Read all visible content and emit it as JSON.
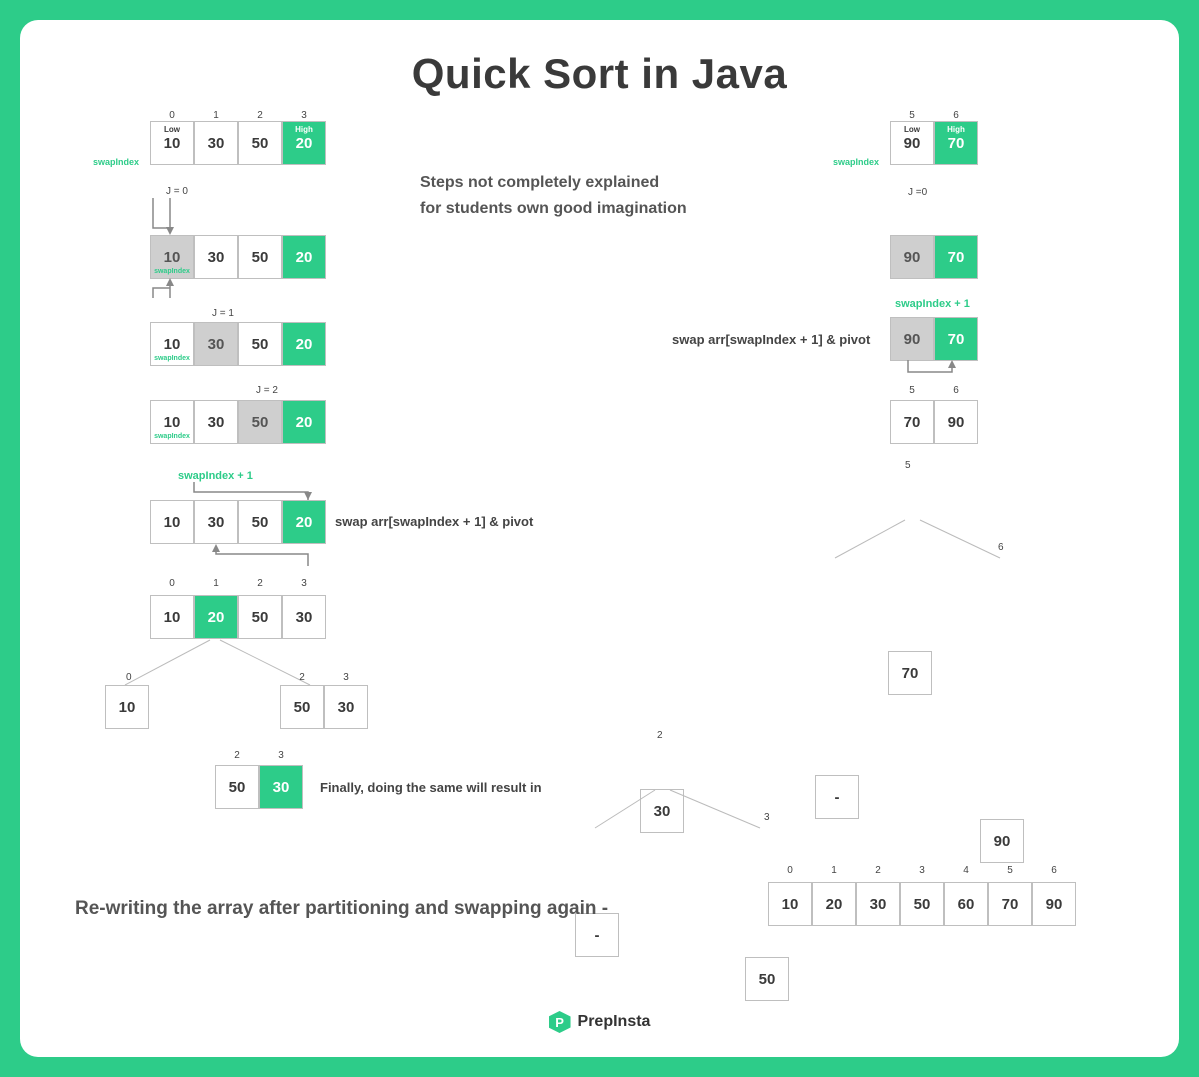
{
  "title": "Quick Sort in Java",
  "subtitle_line1": "Steps not completely explained",
  "subtitle_line2": "for students own good imagination",
  "labels": {
    "swapIndex": "swapIndex",
    "swapIndexPlus1": "swapIndex + 1",
    "low": "Low",
    "high": "High",
    "j0": "J = 0",
    "j1": "J = 1",
    "j2": "J = 2",
    "j0b": "J =0",
    "swapNote": "swap arr[swapIndex + 1] & pivot",
    "finallyNote": "Finally, doing the same will result in",
    "rewrite": "Re-writing the array after partitioning and swapping again -",
    "brand": "PrepInsta",
    "dash": "-"
  },
  "left": {
    "indices": [
      "0",
      "1",
      "2",
      "3"
    ],
    "row1": [
      "10",
      "30",
      "50",
      "20"
    ],
    "row2": [
      "10",
      "30",
      "50",
      "20"
    ],
    "row3": [
      "10",
      "30",
      "50",
      "20"
    ],
    "row4": [
      "10",
      "30",
      "50",
      "20"
    ],
    "row5": [
      "10",
      "30",
      "50",
      "20"
    ],
    "row6": [
      "10",
      "20",
      "50",
      "30"
    ],
    "leaf10": "10",
    "leaf5030": [
      "50",
      "30"
    ],
    "final5030": [
      "50",
      "30"
    ]
  },
  "right": {
    "indices": [
      "5",
      "6"
    ],
    "row1": [
      "90",
      "70"
    ],
    "row2": [
      "90",
      "70"
    ],
    "row3": [
      "90",
      "70"
    ],
    "row4": [
      "70",
      "90"
    ],
    "node70": "70",
    "leafDash": "-",
    "leaf90": "90"
  },
  "tree30": {
    "root": "30",
    "left": "-",
    "right": "50"
  },
  "final": [
    "10",
    "20",
    "30",
    "50",
    "60",
    "70",
    "90"
  ],
  "final_idx": [
    "0",
    "1",
    "2",
    "3",
    "4",
    "5",
    "6"
  ],
  "idx_0": "0",
  "idx_2": "2",
  "idx_3": "3",
  "idx_5": "5",
  "idx_6": "6"
}
